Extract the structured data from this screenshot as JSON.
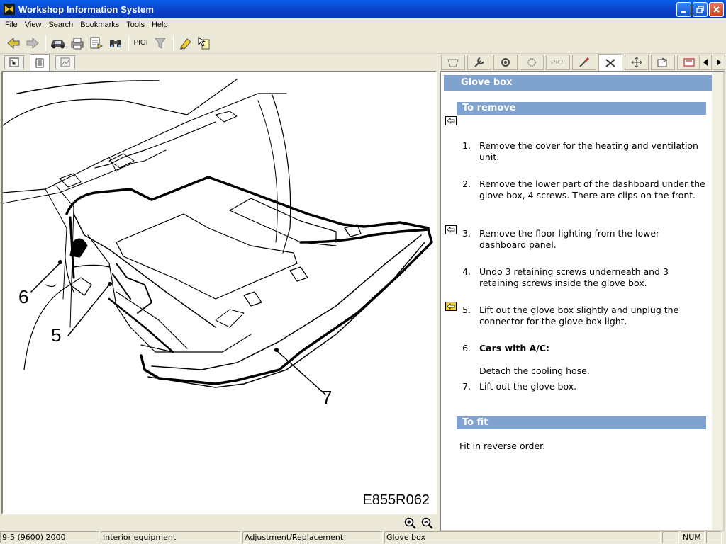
{
  "window": {
    "title": "Workshop Information System"
  },
  "menu": [
    "File",
    "View",
    "Search",
    "Bookmarks",
    "Tools",
    "Help"
  ],
  "toolbar": {
    "pio_label": "PIOI"
  },
  "right_tabs": {
    "pio_label": "PIOI"
  },
  "figure": {
    "labels": {
      "six": "6",
      "five": "5",
      "seven": "7"
    },
    "reference": "E855R062"
  },
  "doc": {
    "title": "Glove box",
    "remove_header": "To remove",
    "steps": [
      {
        "num": "1.",
        "text": "Remove the cover for the heating and ventilation unit."
      },
      {
        "num": "2.",
        "text": "Remove the lower part of the dashboard under the glove box, 4 screws. There are clips on the front."
      },
      {
        "num": "3.",
        "text": "Remove the floor lighting from the lower dashboard panel."
      },
      {
        "num": "4.",
        "text": "Undo 3 retaining screws underneath and 3 retaining screws inside the glove box."
      },
      {
        "num": "5.",
        "text": "Lift out the glove box slightly and unplug the connector for the glove box light."
      },
      {
        "num": "6.",
        "text": "Cars with A/C:"
      },
      {
        "num": "",
        "text": "Detach the cooling hose."
      },
      {
        "num": "7.",
        "text": "Lift out the glove box."
      }
    ],
    "fit_header": "To fit",
    "fit_text": "Fit in reverse order."
  },
  "status": {
    "model": "9-5 (9600) 2000",
    "group": "Interior equipment",
    "type": "Adjustment/Replacement",
    "topic": "Glove box",
    "num": "NUM"
  },
  "colors": {
    "header": "#7fa3ce",
    "titlebar": "#0a4fd9"
  }
}
